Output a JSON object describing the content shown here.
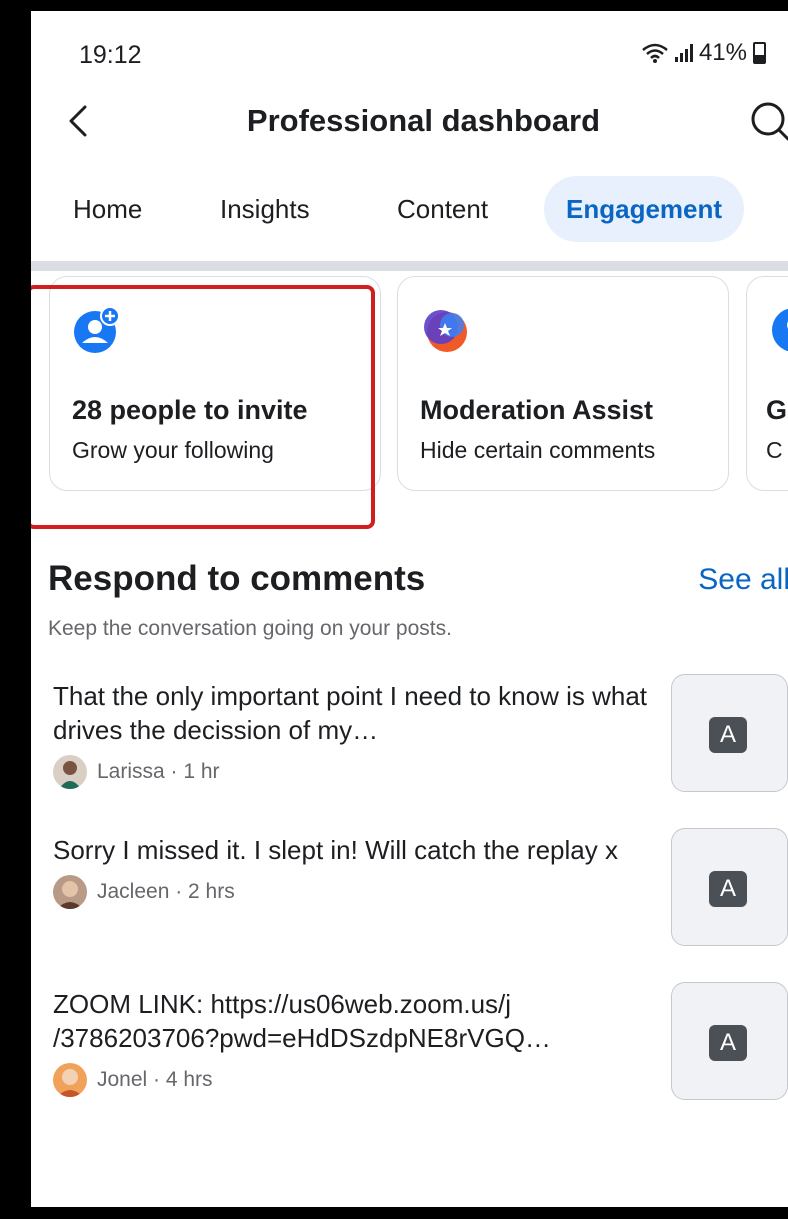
{
  "status_bar": {
    "time": "19:12",
    "battery": "41%"
  },
  "header": {
    "title": "Professional dashboard"
  },
  "tabs": [
    {
      "label": "Home",
      "active": false
    },
    {
      "label": "Insights",
      "active": false
    },
    {
      "label": "Content",
      "active": false
    },
    {
      "label": "Engagement",
      "active": true
    }
  ],
  "cards": [
    {
      "title": "28 people to invite",
      "subtitle": "Grow your following",
      "icon": "add-person-icon"
    },
    {
      "title": "Moderation Assist",
      "subtitle": "Hide certain comments",
      "icon": "moderation-shield-icon"
    },
    {
      "title": "G",
      "subtitle": "C",
      "icon": "person-icon"
    }
  ],
  "section": {
    "title": "Respond to comments",
    "see_all": "See all",
    "subtitle": "Keep the conversation going on your posts."
  },
  "comments": [
    {
      "text": "That the only important point I need to know is what drives the decission of my…",
      "author": "Larissa",
      "meta": "Larissa · 1 hr",
      "thumb_label": "A"
    },
    {
      "text": "Sorry I missed it. I slept in!  Will catch the replay x",
      "author": "Jacleen",
      "meta": "Jacleen · 2 hrs",
      "thumb_label": "A"
    },
    {
      "text": "ZOOM LINK: https://us06web.zoom.us/j /3786203706?pwd=eHdDSzdpNE8rVGQ…",
      "author": "Jonel",
      "meta": "Jonel · 4 hrs",
      "thumb_label": "A"
    }
  ],
  "colors": {
    "accent": "#0a66c2",
    "active_tab_bg": "#e7f0fc",
    "highlight": "#d01f1f"
  }
}
